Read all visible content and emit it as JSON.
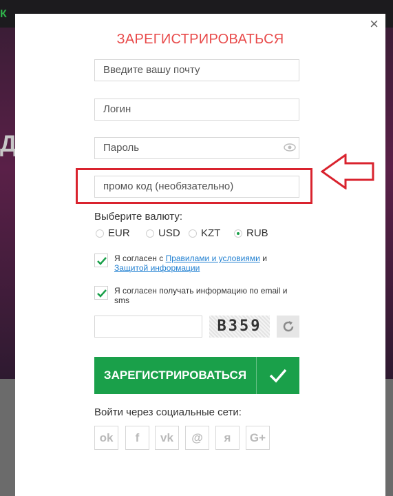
{
  "background": {
    "logo_fragment": "К",
    "side_letter": "Д"
  },
  "modal": {
    "close_glyph": "×",
    "title": "ЗАРЕГИСТРИРОВАТЬСЯ",
    "email_placeholder": "Введите вашу почту",
    "login_placeholder": "Логин",
    "password_placeholder": "Пароль",
    "promo_placeholder": "промо код (необязательно)",
    "currency_label": "Выберите валюту:",
    "currencies": [
      {
        "label": "EUR",
        "checked": false
      },
      {
        "label": "USD",
        "checked": false
      },
      {
        "label": "KZT",
        "checked": false
      },
      {
        "label": "RUB",
        "checked": true
      }
    ],
    "terms": {
      "prefix": "Я согласен с",
      "link1": "Правилами и условиями",
      "middle": "и",
      "link2": "Защитой информации",
      "checked": true
    },
    "marketing": {
      "text": "Я согласен получать информацию по email и sms",
      "checked": true
    },
    "captcha_code": "B359",
    "submit_label": "ЗАРЕГИСТРИРОВАТЬСЯ",
    "social_label": "Войти через социальные сети:",
    "social_buttons": [
      {
        "icon": "odnoklassniki-icon",
        "glyph": "ok"
      },
      {
        "icon": "facebook-icon",
        "glyph": "f"
      },
      {
        "icon": "vk-icon",
        "glyph": "vk"
      },
      {
        "icon": "mail-icon",
        "glyph": "@"
      },
      {
        "icon": "yandex-icon",
        "glyph": "я"
      },
      {
        "icon": "google-plus-icon",
        "glyph": "G+"
      }
    ]
  },
  "colors": {
    "accent_green": "#1aa04a",
    "title_red": "#e84a4a",
    "highlight_red": "#d9232e",
    "link_blue": "#1f7fd1"
  }
}
